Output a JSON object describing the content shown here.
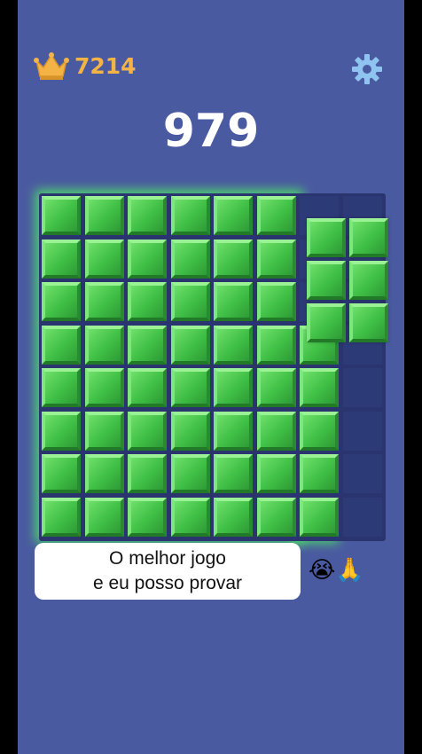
{
  "hud": {
    "best_score": "7214",
    "score": "979",
    "crown_icon": "crown-icon",
    "settings_icon": "gear-icon"
  },
  "board": {
    "columns": 8,
    "rows": 8,
    "filled_color": "#4ccf4f",
    "empty_color": "#2d3a78"
  },
  "piece": {
    "shape": "2x3 block",
    "color": "#4ccf4f"
  },
  "caption": {
    "line1": "O melhor jogo",
    "line2": "e eu posso provar",
    "emoji": "😭🙏"
  },
  "colors": {
    "background": "#4a5aa0",
    "best_score": "#f3b445",
    "score": "#ffffff",
    "glow": "#4dff5a"
  }
}
